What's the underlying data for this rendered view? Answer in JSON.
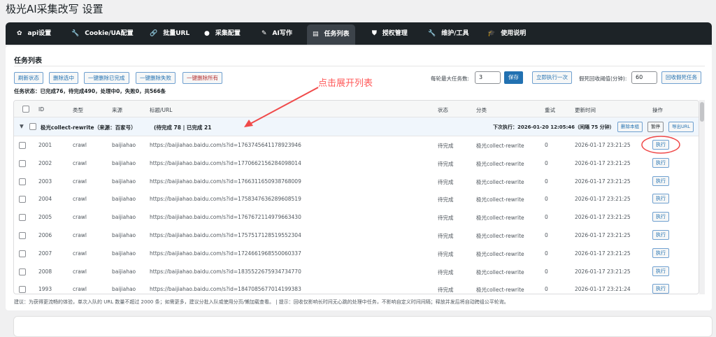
{
  "title": "极光AI采集改写 设置",
  "nav": [
    {
      "label": "api设置",
      "icon": "gear-icon",
      "glyph": "✿"
    },
    {
      "label": "Cookie/UA配置",
      "icon": "wrench-icon",
      "glyph": "🔧"
    },
    {
      "label": "批量URL",
      "icon": "link-icon",
      "glyph": "🔗"
    },
    {
      "label": "采集配置",
      "icon": "globe-icon",
      "glyph": "●"
    },
    {
      "label": "AI写作",
      "icon": "pencil-icon",
      "glyph": "✎"
    },
    {
      "label": "任务列表",
      "icon": "list-icon",
      "glyph": "▤",
      "active": true
    },
    {
      "label": "授权管理",
      "icon": "shield-icon",
      "glyph": "⛊"
    },
    {
      "label": "维护/工具",
      "icon": "wrench-icon",
      "glyph": "🔧"
    },
    {
      "label": "使用说明",
      "icon": "graduation-cap-icon",
      "glyph": "🎓"
    }
  ],
  "card": {
    "title": "任务列表",
    "buttons": {
      "refresh": "刷新状态",
      "delete_selected": "删除选中",
      "delete_done": "一键删除已完成",
      "delete_failed": "一键删除失败",
      "delete_all": "一键删除所有"
    },
    "max_tasks_label": "每轮最大任务数:",
    "max_tasks_value": "3",
    "save": "保存",
    "run_now": "立即执行一次",
    "dead_label": "假死回收阈值(分钟):",
    "dead_value": "60",
    "reclaim": "回收假死任务",
    "status": "任务状态：已完成76，待完成490，处理中0，失败0，共566条"
  },
  "table": {
    "headers": [
      "ID",
      "类型",
      "来源",
      "标题/URL",
      "状态",
      "分类",
      "重试",
      "更新时间",
      "操作"
    ],
    "group": {
      "name": "极光collect-rewrite（来源：百家号）",
      "counts": "(待完成 78 | 已完成 21",
      "next_run": "下次执行：2026-01-20 12:05:46（间隔 75 分钟）",
      "delete_group": "删除本组",
      "pause": "暂停",
      "export": "导出URL"
    },
    "rows": [
      {
        "id": "2001",
        "type": "crawl",
        "source": "baijiahao",
        "url": "https://baijiahao.baidu.com/s?id=1763745641178923946",
        "status": "待完成",
        "category": "极光collect-rewrite",
        "retry": "0",
        "updated": "2026-01-17 23:21:25",
        "action": "执行"
      },
      {
        "id": "2002",
        "type": "crawl",
        "source": "baijiahao",
        "url": "https://baijiahao.baidu.com/s?id=1770662156284098014",
        "status": "待完成",
        "category": "极光collect-rewrite",
        "retry": "0",
        "updated": "2026-01-17 23:21:25",
        "action": "执行"
      },
      {
        "id": "2003",
        "type": "crawl",
        "source": "baijiahao",
        "url": "https://baijiahao.baidu.com/s?id=1766311650938768009",
        "status": "待完成",
        "category": "极光collect-rewrite",
        "retry": "0",
        "updated": "2026-01-17 23:21:25",
        "action": "执行"
      },
      {
        "id": "2004",
        "type": "crawl",
        "source": "baijiahao",
        "url": "https://baijiahao.baidu.com/s?id=1758347636289608519",
        "status": "待完成",
        "category": "极光collect-rewrite",
        "retry": "0",
        "updated": "2026-01-17 23:21:25",
        "action": "执行"
      },
      {
        "id": "2005",
        "type": "crawl",
        "source": "baijiahao",
        "url": "https://baijiahao.baidu.com/s?id=1767672114979663430",
        "status": "待完成",
        "category": "极光collect-rewrite",
        "retry": "0",
        "updated": "2026-01-17 23:21:25",
        "action": "执行"
      },
      {
        "id": "2006",
        "type": "crawl",
        "source": "baijiahao",
        "url": "https://baijiahao.baidu.com/s?id=1757517128519552304",
        "status": "待完成",
        "category": "极光collect-rewrite",
        "retry": "0",
        "updated": "2026-01-17 23:21:25",
        "action": "执行"
      },
      {
        "id": "2007",
        "type": "crawl",
        "source": "baijiahao",
        "url": "https://baijiahao.baidu.com/s?id=1724661968550060337",
        "status": "待完成",
        "category": "极光collect-rewrite",
        "retry": "0",
        "updated": "2026-01-17 23:21:25",
        "action": "执行"
      },
      {
        "id": "2008",
        "type": "crawl",
        "source": "baijiahao",
        "url": "https://baijiahao.baidu.com/s?id=1835522675934734770",
        "status": "待完成",
        "category": "极光collect-rewrite",
        "retry": "0",
        "updated": "2026-01-17 23:21:25",
        "action": "执行"
      },
      {
        "id": "1993",
        "type": "crawl",
        "source": "baijiahao",
        "url": "https://baijiahao.baidu.com/s?id=1847085677014199383",
        "status": "待完成",
        "category": "极光collect-rewrite",
        "retry": "0",
        "updated": "2026-01-17 23:21:24",
        "action": "执行"
      }
    ]
  },
  "note": "建议：为获得更流畅的体验，单次入队的 URL 数量不超过 2000 条；如需更多，建议分批入队或使用分页/懒加载查看。 | 提示：回收仅影响长时间无心跳的处理中任务，不影响自定义时间间隔；释放并发后将自动跨组公平轮询。",
  "annotation": {
    "text": "点击展开列表",
    "color": "#ff5a5a"
  }
}
